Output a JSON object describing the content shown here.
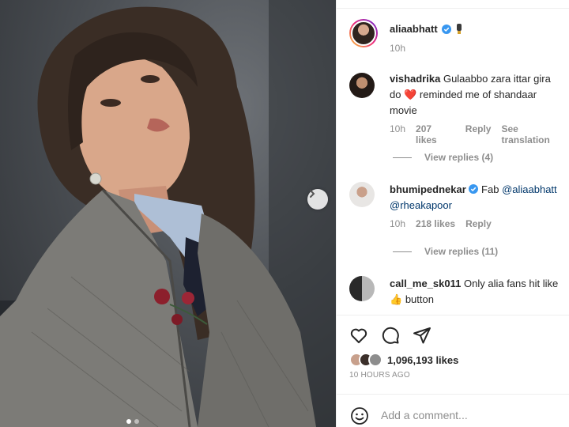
{
  "post": {
    "author": "aliaabhatt",
    "time": "10h"
  },
  "comments": [
    {
      "user": "vishadrika",
      "text_a": "Gulaabbo zara ittar gira do",
      "emoji": "❤️",
      "text_b": "reminded me of shandaar movie",
      "time": "10h",
      "likes": "207 likes",
      "reply": "Reply",
      "translate": "See translation",
      "view_replies": "View replies (4)"
    },
    {
      "user": "bhumipednekar",
      "text_a": "Fab",
      "mention1": "@aliaabhatt",
      "mention2": "@rheakapoor",
      "time": "10h",
      "likes": "218 likes",
      "reply": "Reply",
      "view_replies": "View replies (11)"
    },
    {
      "user": "call_me_sk011",
      "text_a": "Only alia fans hit like",
      "emoji": "👍",
      "text_b": "button"
    }
  ],
  "footer": {
    "likes_count": "1,096,193 likes",
    "posted_ago": "10 HOURS AGO",
    "comment_placeholder": "Add a comment..."
  },
  "icons": {
    "like": "heart-icon",
    "comment": "comment-icon",
    "share": "share-icon",
    "emoji": "emoji-icon",
    "next": "chevron-right-icon",
    "verified": "verified-badge-icon"
  },
  "colors": {
    "verified": "#3897f0",
    "mention": "#00376b",
    "muted": "#8e8e8e",
    "heart": "#ed4956"
  }
}
